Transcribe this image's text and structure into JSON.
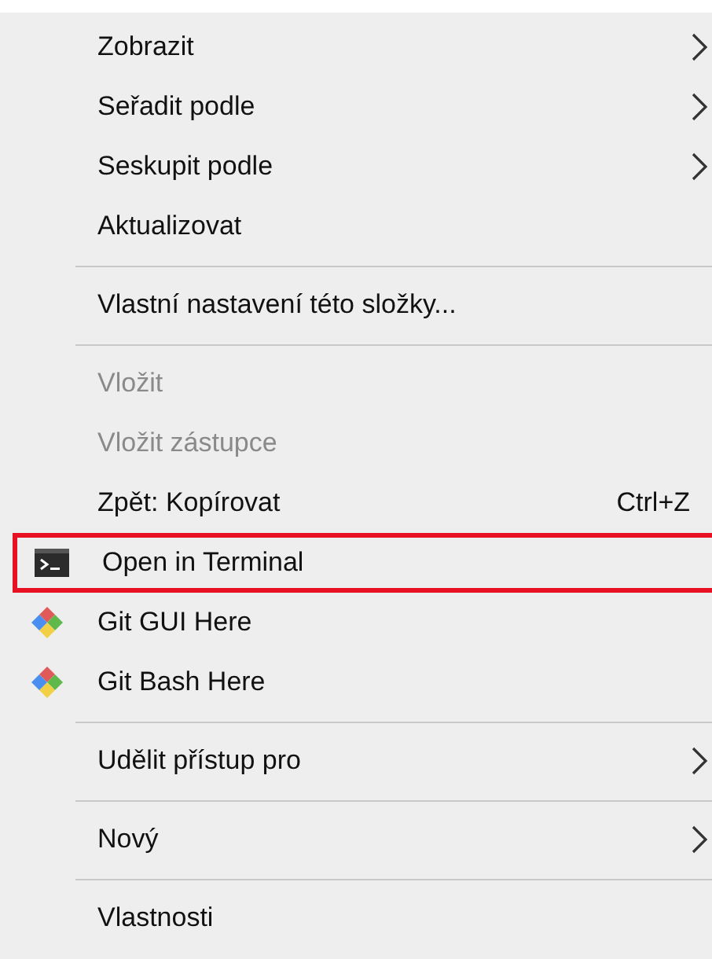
{
  "menu": [
    {
      "kind": "item",
      "label": "Zobrazit",
      "submenu": true,
      "disabled": false,
      "highlighted": false
    },
    {
      "kind": "item",
      "label": "Seřadit podle",
      "submenu": true,
      "disabled": false,
      "highlighted": false
    },
    {
      "kind": "item",
      "label": "Seskupit podle",
      "submenu": true,
      "disabled": false,
      "highlighted": false
    },
    {
      "kind": "item",
      "label": "Aktualizovat",
      "submenu": false,
      "disabled": false,
      "highlighted": false
    },
    {
      "kind": "separator"
    },
    {
      "kind": "item",
      "label": "Vlastní nastavení této složky...",
      "submenu": false,
      "disabled": false,
      "highlighted": false
    },
    {
      "kind": "separator"
    },
    {
      "kind": "item",
      "label": "Vložit",
      "submenu": false,
      "disabled": true,
      "highlighted": false
    },
    {
      "kind": "item",
      "label": "Vložit zástupce",
      "submenu": false,
      "disabled": true,
      "highlighted": false
    },
    {
      "kind": "item",
      "label": "Zpět: Kopírovat",
      "shortcut": "Ctrl+Z",
      "submenu": false,
      "disabled": false,
      "highlighted": false
    },
    {
      "kind": "terminal",
      "label": "Open in Terminal",
      "submenu": false,
      "disabled": false,
      "highlighted": true
    },
    {
      "kind": "git",
      "label": "Git GUI Here",
      "submenu": false,
      "disabled": false,
      "highlighted": false
    },
    {
      "kind": "git",
      "label": "Git Bash Here",
      "submenu": false,
      "disabled": false,
      "highlighted": false
    },
    {
      "kind": "separator"
    },
    {
      "kind": "item",
      "label": "Udělit přístup pro",
      "submenu": true,
      "disabled": false,
      "highlighted": false
    },
    {
      "kind": "separator"
    },
    {
      "kind": "item",
      "label": "Nový",
      "submenu": true,
      "disabled": false,
      "highlighted": false
    },
    {
      "kind": "separator"
    },
    {
      "kind": "item",
      "label": "Vlastnosti",
      "submenu": false,
      "disabled": false,
      "highlighted": false
    }
  ]
}
